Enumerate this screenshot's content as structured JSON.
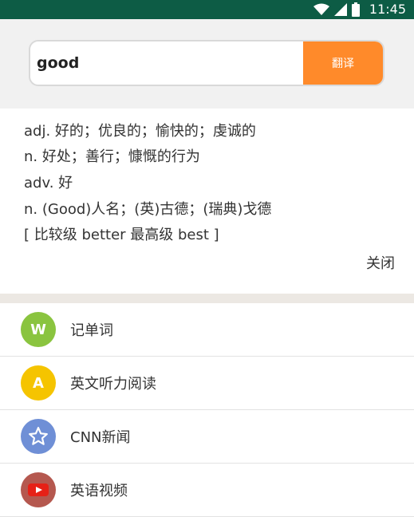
{
  "status_bar": {
    "time": "11:45",
    "icons": [
      "wifi-icon",
      "signal-icon",
      "battery-icon"
    ]
  },
  "search": {
    "query": "good",
    "button_label": "翻译"
  },
  "result": {
    "definitions": [
      "adj. 好的；优良的；愉快的；虔诚的",
      "n. 好处；善行；慷慨的行为",
      "adv. 好",
      "n. (Good)人名；(英)古德；(瑞典)戈德",
      "[ 比较级 better 最高级 best ]"
    ],
    "close_label": "关闭"
  },
  "menu": {
    "items": [
      {
        "label": "记单词",
        "icon": "w-letter-icon",
        "icon_text": "W",
        "color": "#8ac43f"
      },
      {
        "label": "英文听力阅读",
        "icon": "a-letter-icon",
        "icon_text": "A",
        "color": "#f5c400"
      },
      {
        "label": "CNN新闻",
        "icon": "star-icon",
        "color": "#6f8fd6"
      },
      {
        "label": "英语视频",
        "icon": "video-play-icon",
        "color": "#b5584f"
      }
    ]
  },
  "colors": {
    "status_bar": "#0d5c45",
    "accent": "#ff8a2a"
  }
}
